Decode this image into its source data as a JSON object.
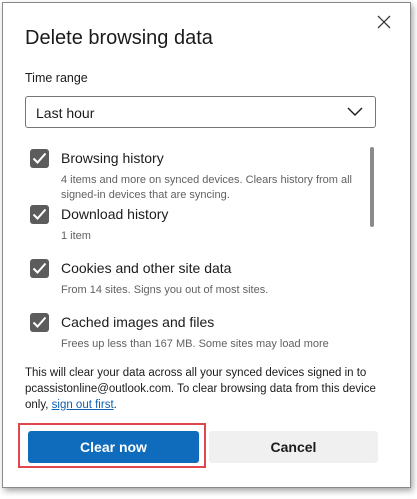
{
  "dialog": {
    "title": "Delete browsing data",
    "close_icon": "close-icon"
  },
  "time_range": {
    "label": "Time range",
    "selected": "Last hour",
    "chevron_icon": "chevron-down-icon"
  },
  "items": [
    {
      "title": "Browsing history",
      "checked": true,
      "description": "4 items and more on synced devices. Clears history from all signed-in devices that are syncing."
    },
    {
      "title": "Download history",
      "checked": true,
      "description": "1 item"
    },
    {
      "title": "Cookies and other site data",
      "checked": true,
      "description": "From 14 sites. Signs you out of most sites."
    },
    {
      "title": "Cached images and files",
      "checked": true,
      "description": "Frees up less than 167 MB. Some sites may load more"
    }
  ],
  "notice": {
    "text_before": "This will clear your data across all your synced devices signed in to pcassistonline@outlook.com. To clear browsing data from this device only, ",
    "link": "sign out first",
    "text_after": "."
  },
  "buttons": {
    "primary": "Clear now",
    "secondary": "Cancel"
  },
  "colors": {
    "primary_button": "#0f6cbd",
    "checkbox": "#5c5c5c",
    "highlight_box": "#e0464c",
    "link": "#0f5fb3"
  }
}
